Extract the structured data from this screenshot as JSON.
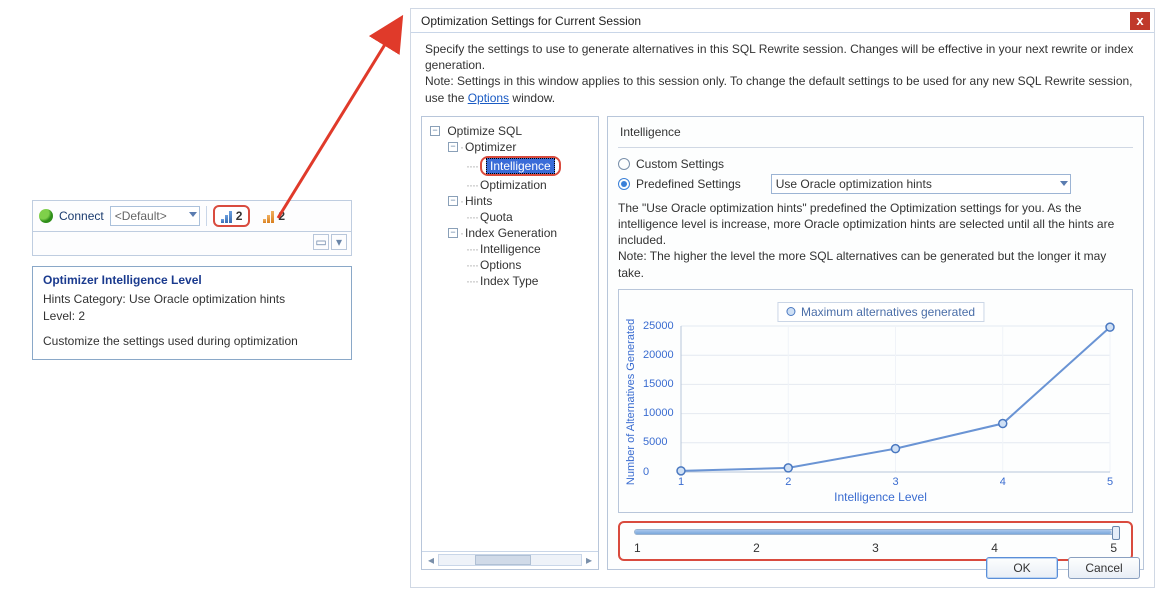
{
  "toolbar": {
    "connect": "Connect",
    "default": "<Default>",
    "level1_num": "2",
    "level2_num": "2"
  },
  "tooltip": {
    "title": "Optimizer Intelligence Level",
    "line1": "Hints Category: Use Oracle optimization hints",
    "line2": "Level: 2",
    "line3": "Customize the settings used during optimization"
  },
  "dialog": {
    "title": "Optimization Settings for Current Session",
    "close": "x",
    "desc1": "Specify the settings to use to generate alternatives in this SQL Rewrite session. Changes will be effective in your next rewrite or index generation.",
    "desc2a": "Note: Settings in this window applies to this session only. To change the default settings to be used for any new SQL Rewrite session, use the ",
    "desc2_link": "Options",
    "desc2b": " window.",
    "ok": "OK",
    "cancel": "Cancel"
  },
  "tree": {
    "n0": "Optimize SQL",
    "n1": "Optimizer",
    "n1a": "Intelligence",
    "n1b": "Optimization",
    "n2": "Hints",
    "n2a": "Quota",
    "n3": "Index Generation",
    "n3a": "Intelligence",
    "n3b": "Options",
    "n3c": "Index Type"
  },
  "panel": {
    "title": "Intelligence",
    "radio_custom": "Custom Settings",
    "radio_predef": "Predefined Settings",
    "combo_value": "Use Oracle optimization hints",
    "explain1": "The \"Use Oracle optimization hints\" predefined the Optimization settings for you. As the intelligence level is increase, more Oracle optimization hints are selected until all the hints are included.",
    "explain2": "Note: The higher the level the more SQL alternatives can be generated but the longer it may take."
  },
  "chart_data": {
    "type": "line",
    "x": [
      1,
      2,
      3,
      4,
      5
    ],
    "values": [
      200,
      700,
      4000,
      8300,
      24800
    ],
    "series_name": "Maximum alternatives generated",
    "xlabel": "Intelligence Level",
    "ylabel": "Number of Alternatives Generated",
    "ylim": [
      0,
      25000
    ],
    "yticks": [
      0,
      5000,
      10000,
      15000,
      20000,
      25000
    ],
    "xticks": [
      1,
      2,
      3,
      4,
      5
    ]
  },
  "slider": {
    "ticks": [
      "1",
      "2",
      "3",
      "4",
      "5"
    ],
    "value": 5
  }
}
